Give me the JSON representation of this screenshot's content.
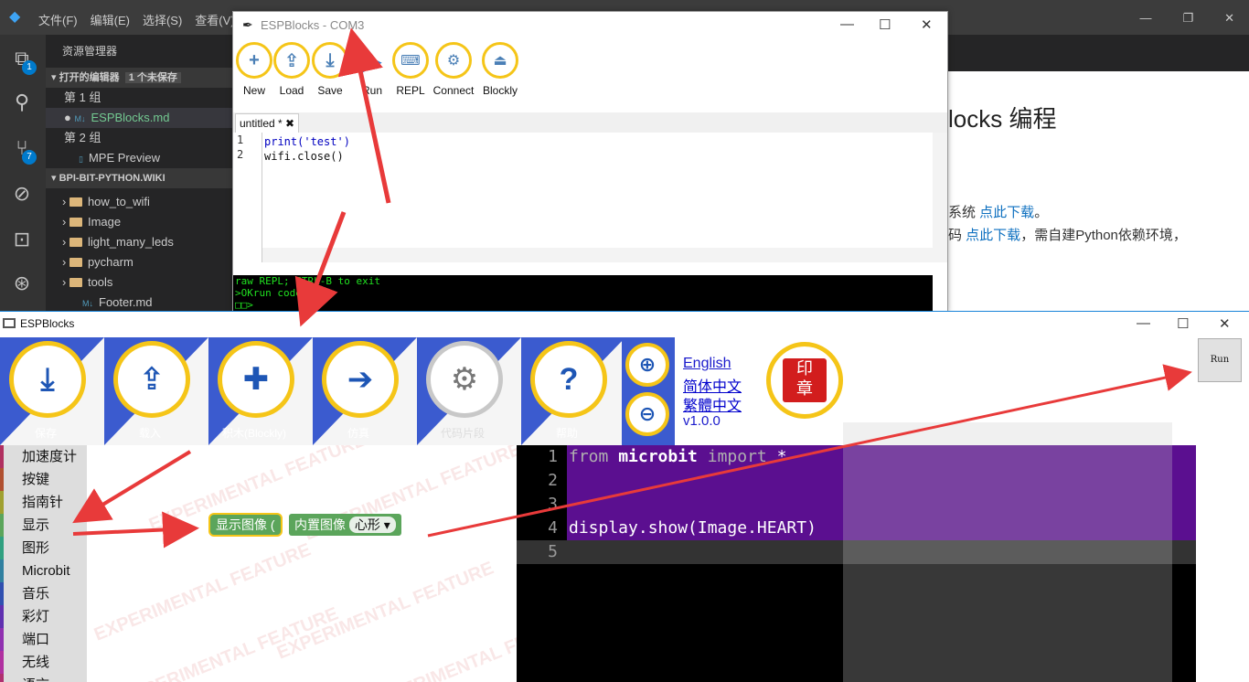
{
  "vscode": {
    "menus": [
      "文件(F)",
      "编辑(E)",
      "选择(S)",
      "查看(V)"
    ],
    "explorer_title": "资源管理器",
    "open_editors": "打开的编辑器",
    "unsaved": "1 个未保存",
    "group1": "第 1 组",
    "group1_file": "ESPBlocks.md",
    "group2": "第 2 组",
    "group2_file": "MPE Preview",
    "workspace": "BPI-BIT-PYTHON.WIKI",
    "folders": [
      "how_to_wifi",
      "Image",
      "light_many_leds",
      "pycharm",
      "tools"
    ],
    "footer_file": "Footer.md",
    "badge_explorer": "1",
    "badge_git": "7",
    "preview_heading": "locks 编程",
    "preview_line1_prefix": "系统 ",
    "preview_link": "点此下载",
    "preview_line1_suffix": "。",
    "preview_line2_prefix": "码 ",
    "preview_line2_suffix": "，需自建Python依赖环境，"
  },
  "small_window": {
    "title": "ESPBlocks - COM3",
    "toolbar": [
      {
        "label": "New",
        "icon": "plus-icon"
      },
      {
        "label": "Load",
        "icon": "upload-icon"
      },
      {
        "label": "Save",
        "icon": "download-icon"
      },
      {
        "label": "Run",
        "icon": "play-icon"
      },
      {
        "label": "REPL",
        "icon": "keyboard-icon"
      },
      {
        "label": "Connect",
        "icon": "gears-icon"
      },
      {
        "label": "Blockly",
        "icon": "device-icon"
      }
    ],
    "tab_label": "untitled *",
    "code_lines": [
      "print('test')",
      "wifi.close()"
    ],
    "repl_lines": [
      "raw REPL; CTRL-B to exit",
      ">OKrun code",
      "□□>"
    ]
  },
  "big_window": {
    "title": "ESPBlocks",
    "header_buttons": [
      {
        "label": "保存",
        "icon": "download-icon"
      },
      {
        "label": "载入",
        "icon": "upload-icon"
      },
      {
        "label": "积木(Blockly)",
        "icon": "puzzle-icon"
      },
      {
        "label": "仿真",
        "icon": "arrow-right-icon"
      },
      {
        "label": "代码片段",
        "icon": "gears-icon"
      },
      {
        "label": "帮助",
        "icon": "question-icon"
      }
    ],
    "languages": [
      "English",
      "简体中文",
      "繁體中文"
    ],
    "version": "v1.0.0",
    "run_label": "Run",
    "categories": [
      "加速度计",
      "按键",
      "指南针",
      "显示",
      "图形",
      "Microbit",
      "音乐",
      "彩灯",
      "端口",
      "无线",
      "语言"
    ],
    "block_show": "显示图像",
    "block_image": "内置图像",
    "block_dropdown": "心形",
    "watermark": "EXPERIMENTAL FEATURE",
    "code_lines": [
      {
        "num": "1",
        "a": "from",
        "b": " microbit ",
        "c": "import",
        "d": " *"
      },
      {
        "num": "2"
      },
      {
        "num": "3"
      },
      {
        "num": "4",
        "text": "display.show(Image.HEART)"
      },
      {
        "num": "5"
      }
    ]
  }
}
